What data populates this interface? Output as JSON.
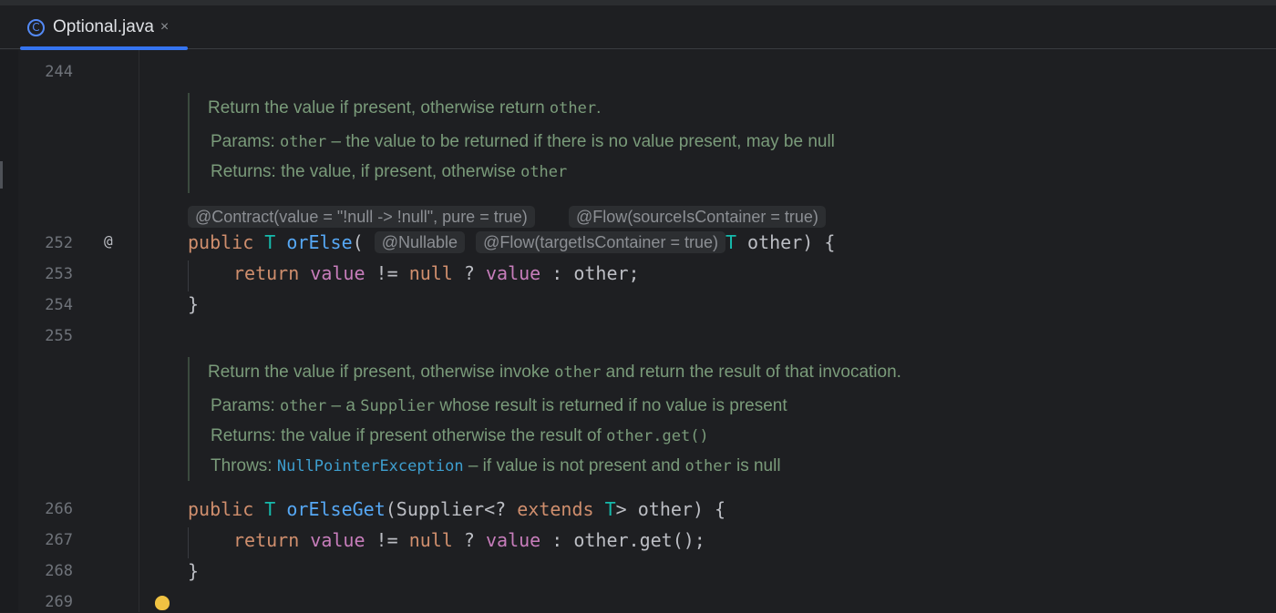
{
  "tab": {
    "label": "Optional.java",
    "close": "×",
    "icon_letter": "C"
  },
  "line_numbers": [
    "244",
    "252",
    "253",
    "254",
    "255",
    "266",
    "267",
    "268",
    "269"
  ],
  "gutter": {
    "at_symbol": "@"
  },
  "doc1": {
    "summary_pre": "Return the value if present, otherwise return ",
    "summary_code": "other",
    "summary_post": ".",
    "params_tag": "Params:",
    "params_code": "other",
    "params_text": " – the value to be returned if there is no value present, may be null",
    "returns_tag": "Returns:",
    "returns_text": "the value, if present, otherwise ",
    "returns_code": "other"
  },
  "hints": {
    "contract": "@Contract(value = \"!null -> !null\", pure = true)",
    "flow": "@Flow(sourceIsContainer = true)",
    "nullable": "@Nullable",
    "flow_target": "@Flow(targetIsContainer = true)"
  },
  "code1": {
    "kw_public": "public",
    "type_t": "T",
    "method": "orElse",
    "open": "(",
    "param": " other) {",
    "kw_return": "return",
    "fld_value": "value",
    "op1": " != ",
    "kw_null": "null",
    "op2": " ? ",
    "op3": " : other;",
    "close": "}"
  },
  "doc2": {
    "summary_pre": "Return the value if present, otherwise invoke ",
    "summary_code": "other",
    "summary_post": " and return the result of that invocation.",
    "params_tag": "Params:",
    "params_code": "other",
    "params_mid": " – a ",
    "params_code2": "Supplier",
    "params_post": " whose result is returned if no value is present",
    "returns_tag": "Returns:",
    "returns_text": "the value if present otherwise the result of ",
    "returns_code": "other.get()",
    "throws_tag": "Throws:",
    "throws_code": "NullPointerException",
    "throws_mid": " – if value is not present and ",
    "throws_code2": "other",
    "throws_post": " is null"
  },
  "code2": {
    "kw_public": "public",
    "type_t": "T",
    "method": "orElseGet",
    "sig_mid": "(Supplier<? ",
    "kw_extends": "extends",
    "sig_end": "> other) {",
    "kw_return": "return",
    "fld_value": "value",
    "op1": " != ",
    "kw_null": "null",
    "op2": " ? ",
    "op3": " : other.get();",
    "close": "}"
  },
  "colors": {
    "background": "#1e1f22",
    "keyword": "#cf8e6d",
    "type": "#16baac",
    "method": "#56a8f5",
    "field": "#c77dbb",
    "doc_text": "#7a9b7a",
    "tab_accent": "#3574f0"
  },
  "icons": {
    "file_type": "class-icon",
    "close": "close-icon",
    "intention": "lightbulb-icon"
  }
}
